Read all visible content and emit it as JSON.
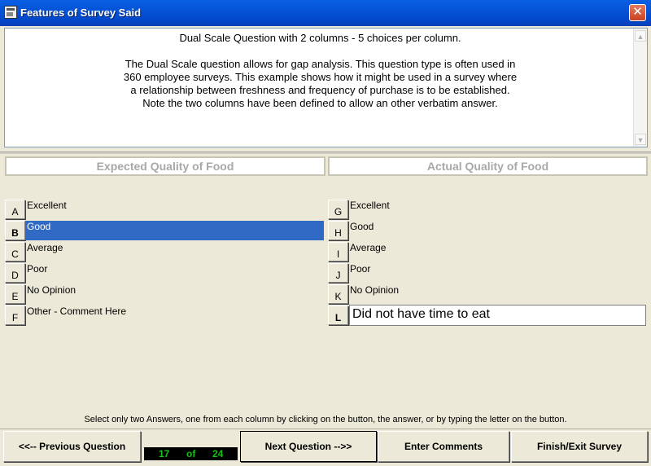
{
  "window": {
    "title": "Features of Survey Said",
    "close_label": "✕"
  },
  "question": {
    "lines": [
      "Dual Scale Question with 2 columns - 5 choices per column.",
      "",
      "The Dual Scale question allows for gap analysis. This question type is often used in",
      "360 employee surveys. This example shows how it might be used in a survey where",
      "a relationship between freshness and frequency of purchase is to be established.",
      "Note the two columns have been defined to allow an other verbatim answer."
    ]
  },
  "columns": {
    "left": {
      "header": "Expected Quality of Food",
      "choices": [
        {
          "letter": "A",
          "label": "Excellent",
          "selected": false
        },
        {
          "letter": "B",
          "label": "Good",
          "selected": true
        },
        {
          "letter": "C",
          "label": "Average",
          "selected": false
        },
        {
          "letter": "D",
          "label": "Poor",
          "selected": false
        },
        {
          "letter": "E",
          "label": "No Opinion",
          "selected": false
        },
        {
          "letter": "F",
          "label": "Other - Comment Here",
          "selected": false
        }
      ]
    },
    "right": {
      "header": "Actual Quality of Food",
      "choices": [
        {
          "letter": "G",
          "label": "Excellent",
          "selected": false
        },
        {
          "letter": "H",
          "label": "Good",
          "selected": false
        },
        {
          "letter": "I",
          "label": "Average",
          "selected": false
        },
        {
          "letter": "J",
          "label": "Poor",
          "selected": false
        },
        {
          "letter": "K",
          "label": "No Opinion",
          "selected": false
        },
        {
          "letter": "L",
          "label": "",
          "selected": true
        }
      ],
      "other_value": "Did not have time to eat"
    }
  },
  "instructions": "Select only two Answers, one from each column by clicking on the button, the answer, or by typing the letter on the button.",
  "nav": {
    "previous": "<<-- Previous Question",
    "next": "Next Question -->>",
    "comments": "Enter Comments",
    "finish": "Finish/Exit Survey"
  },
  "counter": {
    "current": "17",
    "of": "of",
    "total": "24"
  },
  "colors": {
    "selection": "#316ac5",
    "counter_text": "#16c016",
    "titlebar": "#0553d6"
  }
}
